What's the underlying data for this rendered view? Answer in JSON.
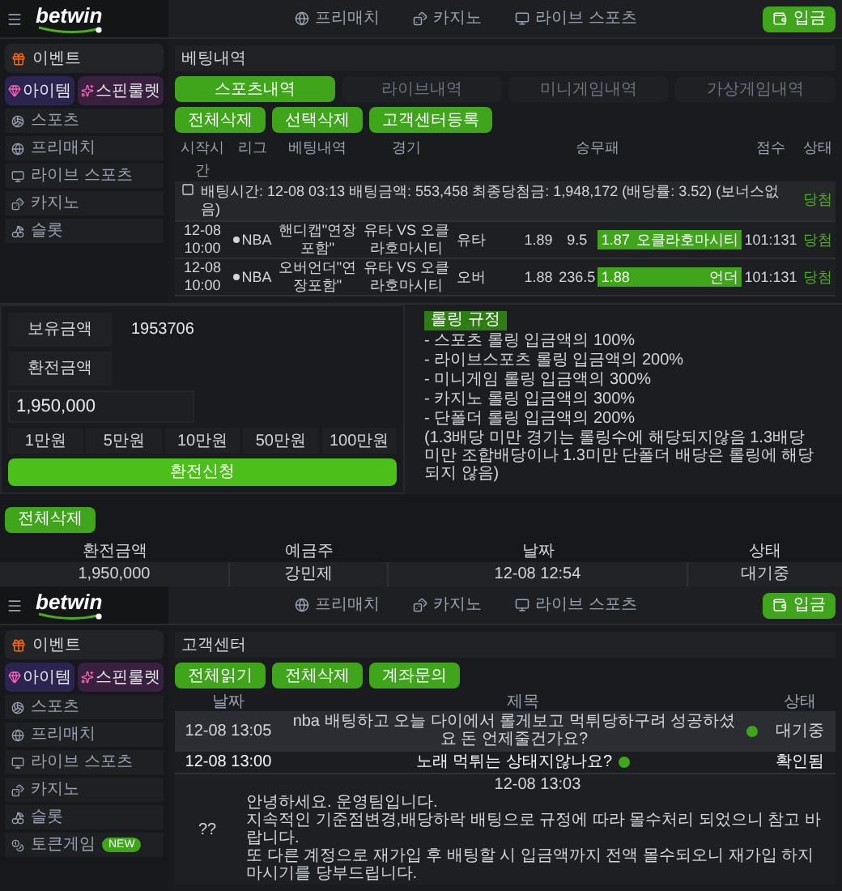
{
  "betting_screen": {
    "header": {
      "logo": "betwin",
      "nav": [
        "프리매치",
        "카지노",
        "라이브 스포츠"
      ],
      "button": "입금"
    },
    "sidebar": {
      "featured": "이벤트",
      "promos": [
        "아이템",
        "스핀룰렛"
      ],
      "items": [
        {
          "label": "스포츠"
        },
        {
          "label": "프리매치"
        },
        {
          "label": "라이브 스포츠"
        },
        {
          "label": "카지노"
        },
        {
          "label": "슬롯"
        }
      ]
    },
    "page_title": "베팅내역",
    "tabs": [
      {
        "label": "스포츠내역",
        "selected": true
      },
      {
        "label": "라이브내역",
        "selected": false
      },
      {
        "label": "미니게임내역",
        "selected": false
      },
      {
        "label": "가상게임내역",
        "selected": false
      }
    ],
    "actions": [
      "전체삭제",
      "선택삭제",
      "고객센터등록"
    ],
    "table": {
      "columns": [
        "시작시간",
        "리그",
        "베팅내역",
        "경기",
        "승무패",
        "점수",
        "상태"
      ],
      "summary": {
        "checked": false,
        "text": "배팅시간: 12-08 03:13 배팅금액: 553,458 최종당첨금: 1,948,172 (배당률: 3.52) (보너스없음)",
        "status": "당첨"
      },
      "rows": [
        {
          "time": "12-08 10:00",
          "league": "NBA",
          "bet_type": "핸디캡\"연장포함\"",
          "match": "유타 VS 오클라호마시티",
          "home": {
            "name": "유타",
            "odds": "1.89",
            "selected": false
          },
          "line": "9.5",
          "away": {
            "odds": "1.87",
            "name": "오클라호마시티",
            "selected": true
          },
          "score": "101:131",
          "status": "당첨"
        },
        {
          "time": "12-08 10:00",
          "league": "NBA",
          "bet_type": "오버언더\"연장포함\"",
          "match": "유타 VS 오클라호마시티",
          "home": {
            "name": "오버",
            "odds": "1.88",
            "selected": false
          },
          "line": "236.5",
          "away": {
            "odds": "1.88",
            "name": "언더",
            "selected": true
          },
          "score": "101:131",
          "status": "당첨"
        }
      ]
    }
  },
  "withdrawal_panel": {
    "balance_label": "보유금액",
    "balance": "1953706",
    "amount_label": "환전금액",
    "amount": "1,950,000",
    "quick_amounts": [
      "1만원",
      "5만원",
      "10만원",
      "50만원",
      "100만원"
    ],
    "submit": "환전신청"
  },
  "rules_panel": {
    "title": "롤링 규정",
    "lines": [
      "- 스포츠 롤링 입금액의 100%",
      "- 라이브스포츠 롤링 입금액의 200%",
      "- 미니게임 롤링 입금액의 300%",
      "- 카지노 롤링 입금액의 300%",
      "- 단폴더 롤링 입금액의 200%",
      "(1.3배당 미만 경기는 롤링수에 해당되지않음 1.3배당 미만 조합배당이나 1.3미만 단폴더 배당은 롤링에 해당되지 않음)"
    ]
  },
  "withdrawal_history": {
    "delete_all": "전체삭제",
    "columns": [
      "환전금액",
      "예금주",
      "날짜",
      "상태"
    ],
    "rows": [
      {
        "amount": "1,950,000",
        "holder": "강민제",
        "date": "12-08 12:54",
        "status": "대기중"
      }
    ]
  },
  "support_screen": {
    "header": {
      "logo": "betwin",
      "nav": [
        "프리매치",
        "카지노",
        "라이브 스포츠"
      ],
      "button": "입금"
    },
    "sidebar": {
      "featured": "이벤트",
      "promos": [
        "아이템",
        "스핀룰렛"
      ],
      "items": [
        {
          "label": "스포츠"
        },
        {
          "label": "프리매치"
        },
        {
          "label": "라이브 스포츠"
        },
        {
          "label": "카지노"
        },
        {
          "label": "슬롯"
        },
        {
          "label": "토큰게임",
          "badge": "NEW"
        }
      ]
    },
    "page_title": "고객센터",
    "actions": [
      "전체읽기",
      "전체삭제",
      "계좌문의"
    ],
    "table": {
      "columns": [
        "날짜",
        "제목",
        "상태"
      ],
      "rows": [
        {
          "date": "12-08 13:05",
          "title": "nba 배팅하고 오늘 다이에서 롤게보고 먹튀당하구려 성공하셨요 돈 언제줄건가요?",
          "status": "대기중",
          "expanded": false
        },
        {
          "date": "12-08 13:00",
          "title": "노래 먹튀는 상태지않나요?",
          "status": "확인됨",
          "expanded": true,
          "question": "??",
          "reply": {
            "date": "12-08 13:03",
            "lines": [
              "안녕하세요. 운영팀입니다.",
              "지속적인 기준점변경,배당하락 배팅으로 규정에 따라 몰수처리 되었으니 참고 바랍니다.",
              "또 다른 계정으로 재가입 후 배팅할 시 입금액까지 전액 몰수되오니 재가입 하지마시기를 당부드립니다."
            ]
          }
        }
      ]
    }
  }
}
